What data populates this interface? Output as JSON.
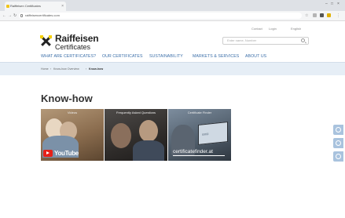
{
  "browser": {
    "tab_title": "Raiffeisen Certificates",
    "url": "raiffeisencertificates.com"
  },
  "header": {
    "logo_word": "Raiffeisen",
    "logo_sub": "Certificates",
    "top_links": [
      "Contact",
      "Login",
      "English"
    ],
    "search_placeholder": "Enter name, Number"
  },
  "main_nav": [
    "WHAT ARE CERTIFICATES?",
    "OUR CERTIFICATES",
    "SUSTAINABILITY",
    "MARKETS & SERVICES",
    "ABOUT US"
  ],
  "breadcrumb": [
    "Home",
    "Know-how Overview",
    "Know-how"
  ],
  "page": {
    "title": "Know-how"
  },
  "cards": [
    {
      "label": "Videos",
      "badge": "YouTube"
    },
    {
      "label": "Frequently Asked Questions"
    },
    {
      "label": "Certificate Finder",
      "text": "certificatefinder.at"
    }
  ],
  "colors": {
    "nav_blue": "#3a6ea8",
    "breadcrumb_band": "#e6eef6",
    "logo_yellow": "#f5d000",
    "side_icons": "#a9c3de"
  }
}
